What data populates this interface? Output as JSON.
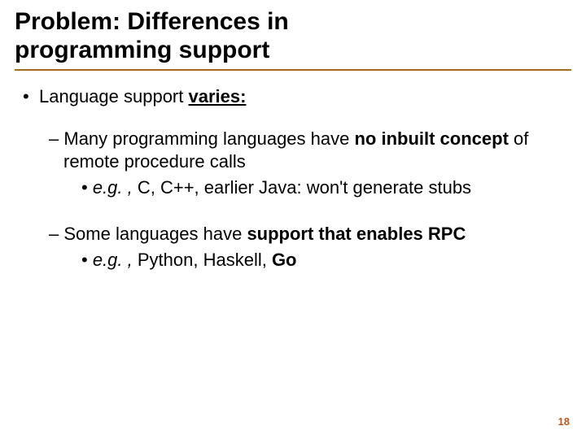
{
  "title_line1": "Problem: Differences in",
  "title_line2": "programming support",
  "bullet1_prefix": "Language support ",
  "bullet1_bold": "varies:",
  "sub1_prefix": "Many programming languages have ",
  "sub1_bold": "no inbuilt concept",
  "sub1_suffix": " of remote procedure calls",
  "sub1_eg_label": "e.g. ,",
  "sub1_eg_text": " C, C++, earlier Java: won't generate stubs",
  "sub2_prefix": "Some languages have ",
  "sub2_bold": "support that enables RPC",
  "sub2_eg_label": "e.g. ,",
  "sub2_eg_text": " Python, Haskell, ",
  "sub2_eg_bold": "Go",
  "page_number": "18",
  "glyphs": {
    "dot": "•",
    "dash": "–"
  }
}
